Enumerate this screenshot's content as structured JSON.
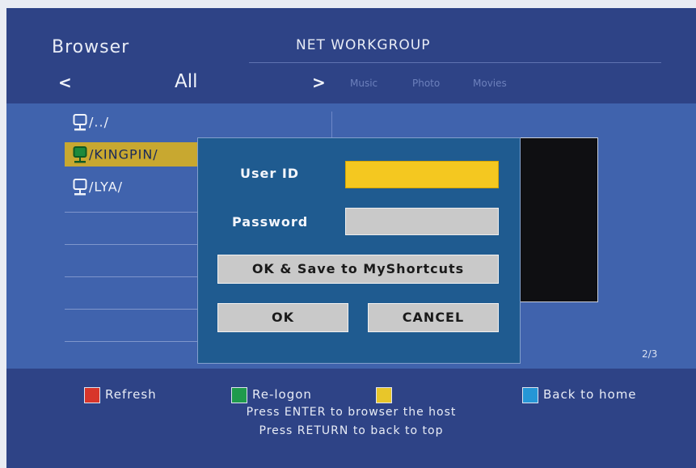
{
  "header": {
    "title": "Browser",
    "workgroup": "NET WORKGROUP",
    "nav_prev": "<",
    "nav_current": "All",
    "nav_next": ">",
    "tabs": [
      "Music",
      "Photo",
      "Movies"
    ]
  },
  "list": {
    "items": [
      {
        "label": "/../",
        "icon": "network-computer-icon",
        "selected": false
      },
      {
        "label": "/KINGPIN/",
        "icon": "network-computer-icon",
        "selected": true
      },
      {
        "label": "/LYA/",
        "icon": "network-computer-icon",
        "selected": false
      }
    ],
    "page": "2/3"
  },
  "dialog": {
    "user_id_label": "User ID",
    "user_id_value": "",
    "password_label": "Password",
    "password_value": "",
    "save_shortcut_label": "OK & Save to MyShortcuts",
    "ok_label": "OK",
    "cancel_label": "CANCEL"
  },
  "footer": {
    "legend": [
      {
        "label": "Refresh",
        "color": "#d8352a"
      },
      {
        "label": "Re-logon",
        "color": "#1f9a4c"
      },
      {
        "label": "",
        "color": "#e8c62a"
      },
      {
        "label": "Back to home",
        "color": "#2596d6"
      }
    ],
    "hint_enter": "Press ENTER to browser the host",
    "hint_return": "Press RETURN to back to top"
  },
  "colors": {
    "background": "#3a4f8e",
    "header": "#2e4386",
    "selection": "#c8a830",
    "focus_field": "#f4c820"
  }
}
